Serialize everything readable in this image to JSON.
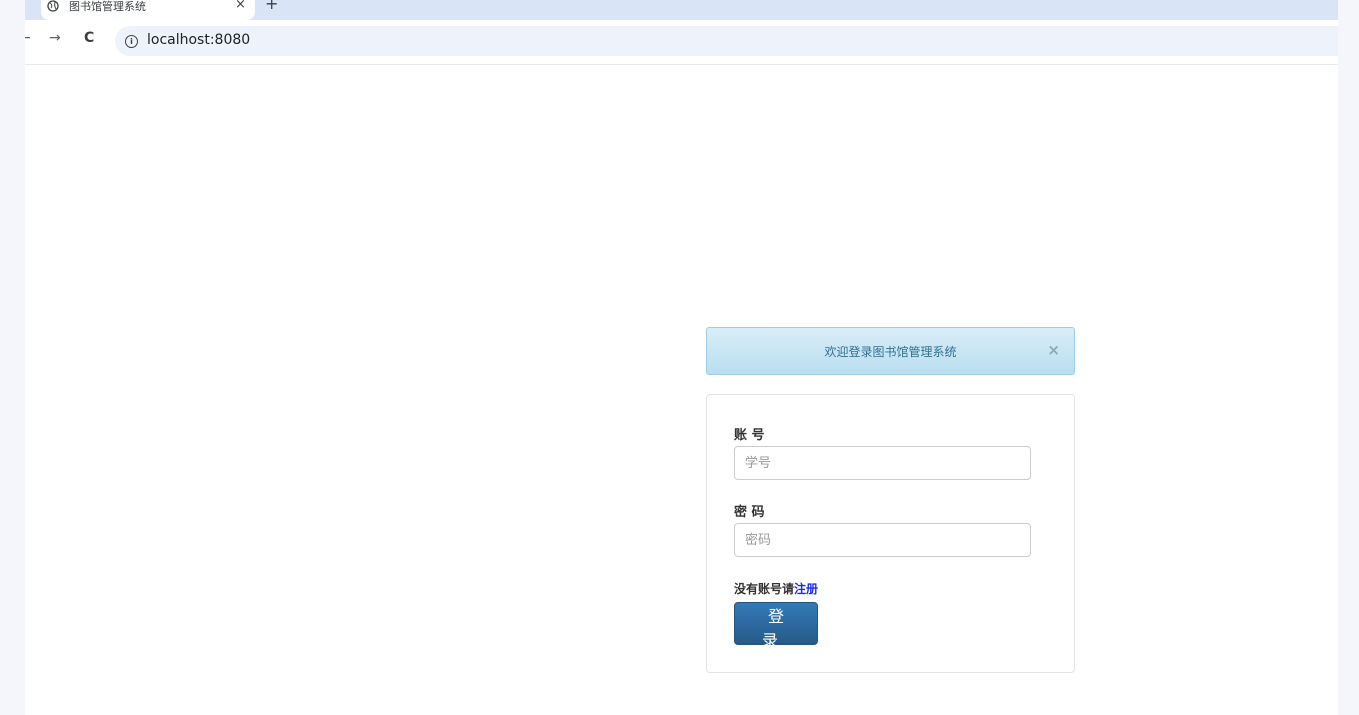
{
  "browser": {
    "tab_title": "图书馆管理系统",
    "tab_close": "×",
    "new_tab": "+",
    "back": "←",
    "forward": "→",
    "reload": "C",
    "url": "localhost:8080"
  },
  "alert": {
    "message": "欢迎登录图书馆管理系统",
    "close": "×"
  },
  "form": {
    "account_label": "账 号",
    "account_placeholder": "学号",
    "password_label": "密 码",
    "password_placeholder": "密码",
    "register_prompt": "没有账号请",
    "register_link": "注册",
    "login_button": "登 录"
  }
}
